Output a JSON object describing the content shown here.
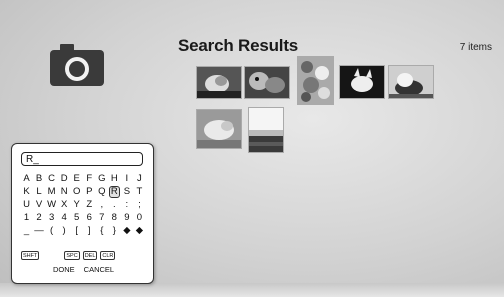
{
  "header": {
    "title": "Search Results",
    "count": "7 items"
  },
  "search": {
    "value": "R_"
  },
  "keyboard": {
    "rows": [
      [
        "A",
        "B",
        "C",
        "D",
        "E",
        "F",
        "G",
        "H",
        "I",
        "J"
      ],
      [
        "K",
        "L",
        "M",
        "N",
        "O",
        "P",
        "Q",
        "R",
        "S",
        "T"
      ],
      [
        "U",
        "V",
        "W",
        "X",
        "Y",
        "Z",
        ",",
        ".",
        ":",
        ";"
      ],
      [
        "1",
        "2",
        "3",
        "4",
        "5",
        "6",
        "7",
        "8",
        "9",
        "0"
      ],
      [
        "_",
        "—",
        "(",
        ")",
        "[",
        "]",
        "{",
        "}",
        "◆",
        "◆"
      ]
    ],
    "selected": "R",
    "functions": [
      "SHFT",
      "SPC",
      "DEL",
      "CLR"
    ],
    "actions": [
      "DONE",
      "CANCEL"
    ]
  },
  "results": {
    "icons": [
      "camera-icon"
    ],
    "thumbnails": [
      "thumbnail-1",
      "thumbnail-2",
      "thumbnail-3",
      "thumbnail-4",
      "thumbnail-5",
      "thumbnail-6",
      "thumbnail-7"
    ]
  }
}
